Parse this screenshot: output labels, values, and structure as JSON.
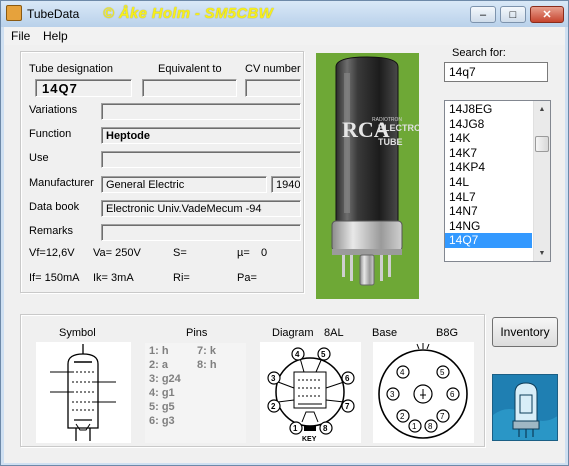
{
  "window": {
    "title": "TubeData",
    "credit": "© Åke Holm - SM5CBW",
    "minimize_glyph": "–",
    "maximize_glyph": "□",
    "close_glyph": "✕"
  },
  "menu": [
    "File",
    "Help"
  ],
  "headers": {
    "designation": "Tube designation",
    "equivalent": "Equivalent to",
    "cv": "CV number"
  },
  "tube": {
    "designation": "14Q7",
    "equivalent": "",
    "cv": "",
    "variations": "",
    "function": "Heptode",
    "use": "",
    "manufacturer": "General Electric",
    "year": "1940",
    "databook": "Electronic Univ.VadeMecum -94",
    "remarks": ""
  },
  "labels": {
    "variations": "Variations",
    "function": "Function",
    "use": "Use",
    "manufacturer": "Manufacturer",
    "databook": "Data book",
    "remarks": "Remarks"
  },
  "params": {
    "vf": "Vf=12,6V",
    "va": "Va= 250V",
    "s": "S=",
    "mu": "µ=",
    "mu_val": "0",
    "if": "If= 150mA",
    "ik": "Ik= 3mA",
    "ri": "Ri=",
    "pa": "Pa="
  },
  "search": {
    "label": "Search for:",
    "value": "14q7"
  },
  "tube_list": [
    "14J8EG",
    "14JG8",
    "14K",
    "14K7",
    "14KP4",
    "14L",
    "14L7",
    "14N7",
    "14NG",
    "14Q7"
  ],
  "selected_tube": "14Q7",
  "photo_text": {
    "brand": "RCA",
    "small": "RADIOTRON",
    "line2": "ELECTRON",
    "line3": "TUBE"
  },
  "bottom": {
    "symbol_label": "Symbol",
    "pins_label": "Pins",
    "diagram_label": "Diagram",
    "diagram_code": "8AL",
    "base_label": "Base",
    "base_code": "B8G",
    "key_label": "KEY"
  },
  "pins": [
    "1: h",
    "2: a",
    "3: g24",
    "4: g1",
    "5: g5",
    "6: g3",
    "7: k",
    "8: h"
  ],
  "base_numbers": [
    "1",
    "2",
    "3",
    "4",
    "5",
    "6",
    "7",
    "8"
  ],
  "inventory_button": "Inventory",
  "colors": {
    "selection": "#3399ff",
    "credit": "#f7f01a",
    "photo_background": "#6ea836"
  }
}
